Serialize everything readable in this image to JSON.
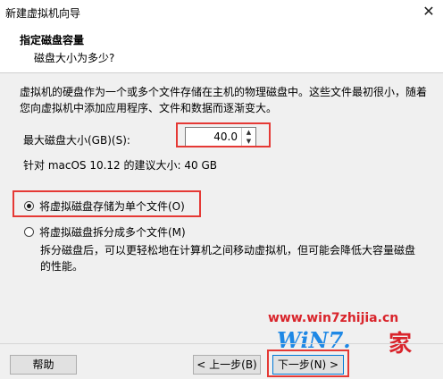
{
  "window": {
    "title": "新建虚拟机向导",
    "close_glyph": "✕"
  },
  "header": {
    "title": "指定磁盘容量",
    "subtitle": "磁盘大小为多少?"
  },
  "description": "虚拟机的硬盘作为一个或多个文件存储在主机的物理磁盘中。这些文件最初很小，随着您向虚拟机中添加应用程序、文件和数据而逐渐变大。",
  "disk_size": {
    "label": "最大磁盘大小(GB)(S):",
    "value": "40.0"
  },
  "recommendation": "针对 macOS 10.12 的建议大小: 40 GB",
  "options": [
    {
      "label": "将虚拟磁盘存储为单个文件(O)",
      "selected": true
    },
    {
      "label": "将虚拟磁盘拆分成多个文件(M)",
      "selected": false
    }
  ],
  "split_description": "拆分磁盘后，可以更轻松地在计算机之间移动虚拟机，但可能会降低大容量磁盘的性能。",
  "watermark": {
    "url": "www.win7zhijia.cn",
    "logo": "WiN7.",
    "jia": "家"
  },
  "buttons": {
    "help": "帮助",
    "back": "< 上一步(B)",
    "next": "下一步(N) >"
  },
  "colors": {
    "highlight": "#e53935",
    "watermark_red": "#d9242b",
    "watermark_blue": "#1e88e5"
  }
}
